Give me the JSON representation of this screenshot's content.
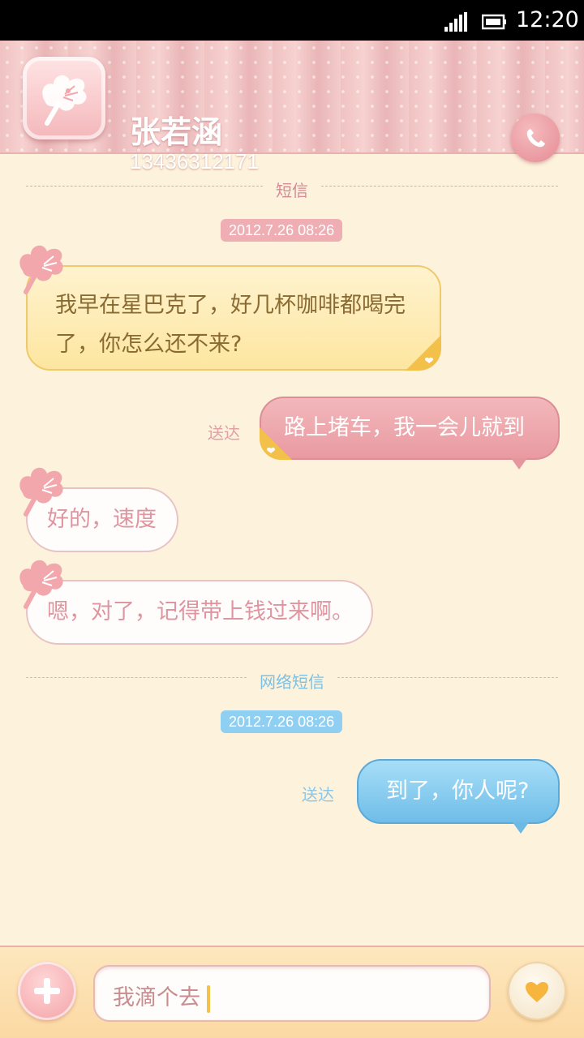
{
  "status_bar": {
    "time": "12:20"
  },
  "header": {
    "contact_name": "张若涵",
    "contact_phone": "13436312171"
  },
  "sections": [
    {
      "label": "短信",
      "timestamp": "2012.7.26  08:26",
      "messages": [
        {
          "direction": "incoming",
          "text_line1": "我早在星巴克了，好几杯咖啡都喝完",
          "text_line2": "了，你怎么还不来?"
        },
        {
          "direction": "outgoing",
          "status": "送达",
          "text": "路上堵车，我一会儿就到"
        },
        {
          "direction": "incoming",
          "text": "好的，速度"
        },
        {
          "direction": "incoming",
          "text": "嗯，对了，记得带上钱过来啊。"
        }
      ]
    },
    {
      "label": "网络短信",
      "timestamp": "2012.7.26  08:26",
      "messages": [
        {
          "direction": "outgoing",
          "status": "送达",
          "text": "到了，你人呢?"
        }
      ]
    }
  ],
  "input_bar": {
    "text": "我滴个去"
  },
  "icons": {
    "avatar": "flower-icon",
    "call": "phone-icon",
    "add": "plus-icon",
    "send": "heart-icon",
    "signal": "signal-icon",
    "battery": "battery-icon"
  },
  "colors": {
    "pink_accent": "#e99aa1",
    "blue_accent": "#6fbde8",
    "yellow_bubble": "#fde6a0",
    "background": "#fdf2dc"
  }
}
